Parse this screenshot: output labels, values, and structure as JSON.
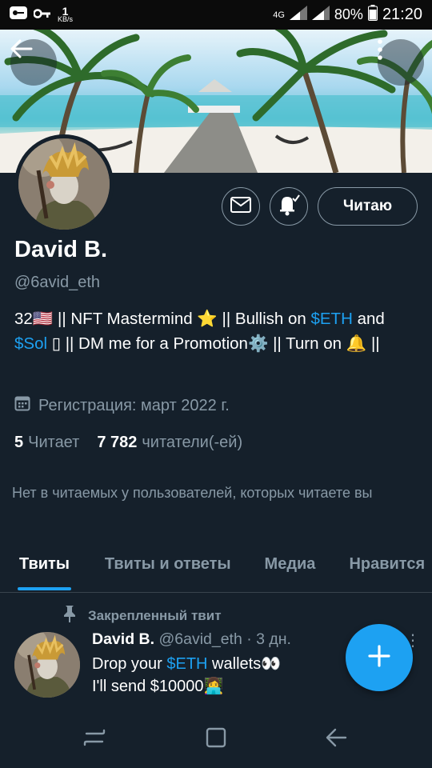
{
  "status_bar": {
    "kbs_value": "1",
    "kbs_unit": "KB/s",
    "network": "4G",
    "battery": "80%",
    "time": "21:20"
  },
  "profile": {
    "name": "David B.",
    "handle": "@6avid_eth",
    "bio_parts": [
      "32🇺🇸 || NFT Mastermind ⭐ || Bullish on ",
      "$ETH",
      " and ",
      "$Sol",
      " ▯ || DM me for a Promotion⚙️ || Turn on 🔔 ||"
    ],
    "registration": "Регистрация: март 2022 г.",
    "following_count": "5",
    "following_label": "Читает",
    "followers_count": "7 782",
    "followers_label": "читатели(-ей)",
    "follow_button": "Читаю",
    "mutual_note": "Нет в читаемых у пользователей, которых читаете вы"
  },
  "tabs": [
    {
      "label": "Твиты",
      "active": true
    },
    {
      "label": "Твиты и ответы",
      "active": false
    },
    {
      "label": "Медиа",
      "active": false
    },
    {
      "label": "Нравится",
      "active": false
    }
  ],
  "pinned_tweet": {
    "pin_label": "Закрепленный твит",
    "author": "David B.",
    "meta": "@6avid_eth · 3 дн.",
    "line1_prefix": "Drop your ",
    "line1_link": "$ETH",
    "line1_suffix": " wallets👀",
    "line2": "I'll send $10000👩‍💻"
  },
  "icons": [
    "back-arrow-icon",
    "more-vertical-icon",
    "mail-icon",
    "bell-notify-icon",
    "calendar-icon",
    "pin-icon",
    "plus-icon",
    "recents-icon",
    "home-icon",
    "back-nav-icon"
  ],
  "colors": {
    "accent": "#1da1f2",
    "background": "#15202b",
    "secondary_text": "#8899a6"
  }
}
